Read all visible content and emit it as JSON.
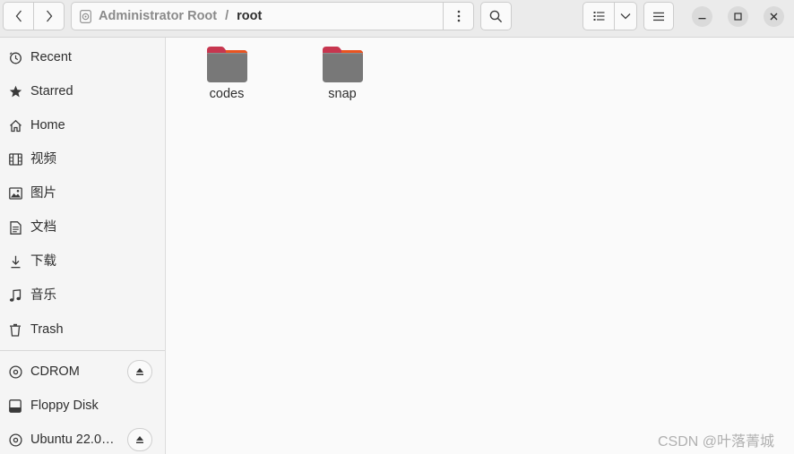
{
  "header": {
    "path": {
      "crumb_root": "Administrator Root",
      "separator": "/",
      "crumb_current": "root"
    }
  },
  "sidebar": {
    "items": [
      {
        "label": "Recent",
        "icon": "clock-icon"
      },
      {
        "label": "Starred",
        "icon": "star-icon"
      },
      {
        "label": "Home",
        "icon": "home-icon"
      },
      {
        "label": "视频",
        "icon": "film-icon"
      },
      {
        "label": "图片",
        "icon": "picture-icon"
      },
      {
        "label": "文档",
        "icon": "document-icon"
      },
      {
        "label": "下载",
        "icon": "download-icon"
      },
      {
        "label": "音乐",
        "icon": "music-icon"
      },
      {
        "label": "Trash",
        "icon": "trash-icon"
      }
    ],
    "devices": [
      {
        "label": "CDROM",
        "icon": "disc-icon",
        "eject": true
      },
      {
        "label": "Floppy Disk",
        "icon": "drive-icon",
        "eject": false
      },
      {
        "label": "Ubuntu 22.0…",
        "icon": "disc-icon",
        "eject": true
      }
    ]
  },
  "files": [
    {
      "name": "codes",
      "icon": "folder-icon"
    },
    {
      "name": "snap",
      "icon": "folder-icon"
    }
  ],
  "colors": {
    "folder_tab": "#c7364f",
    "folder_tab_accent": "#e95420",
    "folder_body": "#787878"
  },
  "watermark": "CSDN @叶落菁城"
}
